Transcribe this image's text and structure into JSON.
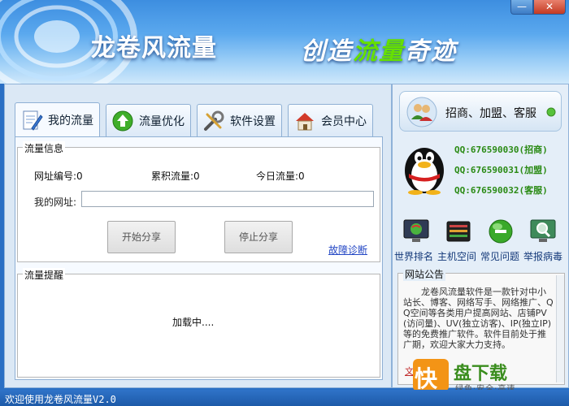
{
  "header": {
    "app_title": "龙卷风流量",
    "slogan_part1": "创造",
    "slogan_part2": "流量",
    "slogan_part3": "奇迹",
    "minimize_label": "—",
    "close_label": "✕"
  },
  "tabs": [
    {
      "label": "我的流量",
      "icon": "document-pen-icon",
      "active": true
    },
    {
      "label": "流量优化",
      "icon": "up-arrow-icon",
      "active": false
    },
    {
      "label": "软件设置",
      "icon": "tools-icon",
      "active": false
    },
    {
      "label": "会员中心",
      "icon": "house-icon",
      "active": false
    }
  ],
  "traffic_info": {
    "group_title": "流量信息",
    "site_id": "网址编号:0",
    "total_traffic": "累积流量:0",
    "today_traffic": "今日流量:0",
    "url_label": "我的网址:",
    "url_value": "",
    "start_button": "开始分享",
    "stop_button": "停止分享",
    "diagnose_link": "故障诊断"
  },
  "traffic_reminder": {
    "group_title": "流量提醒",
    "loading_text": "加载中...."
  },
  "sidebar": {
    "merchant_label": "招商、加盟、客服",
    "qq_lines": [
      "QQ:676590030(招商)",
      "QQ:676590031(加盟)",
      "QQ:676590032(客服)"
    ],
    "shortcuts": [
      {
        "label": "世界排名",
        "icon": "globe-monitor-icon"
      },
      {
        "label": "主机空间",
        "icon": "server-icon"
      },
      {
        "label": "常见问题",
        "icon": "green-orb-icon"
      },
      {
        "label": "举报病毒",
        "icon": "magnifier-monitor-icon"
      }
    ],
    "notice_title": "网站公告",
    "notice_text": "龙卷风流量软件是一款针对中小站长、博客、网络写手、网络推广、QQ空间等各类用户提高网站、店铺PV(访问量)、UV(独立访客)、IP(独立IP)等的免费推广软件。软件目前处于推广期，欢迎大家大力支持。",
    "notice_link": "文"
  },
  "watermark": {
    "char": "快",
    "main": "盘下载",
    "sub": "绿色·安全·高速"
  },
  "status_bar": {
    "text": "欢迎使用龙卷风流量V2.0"
  }
}
